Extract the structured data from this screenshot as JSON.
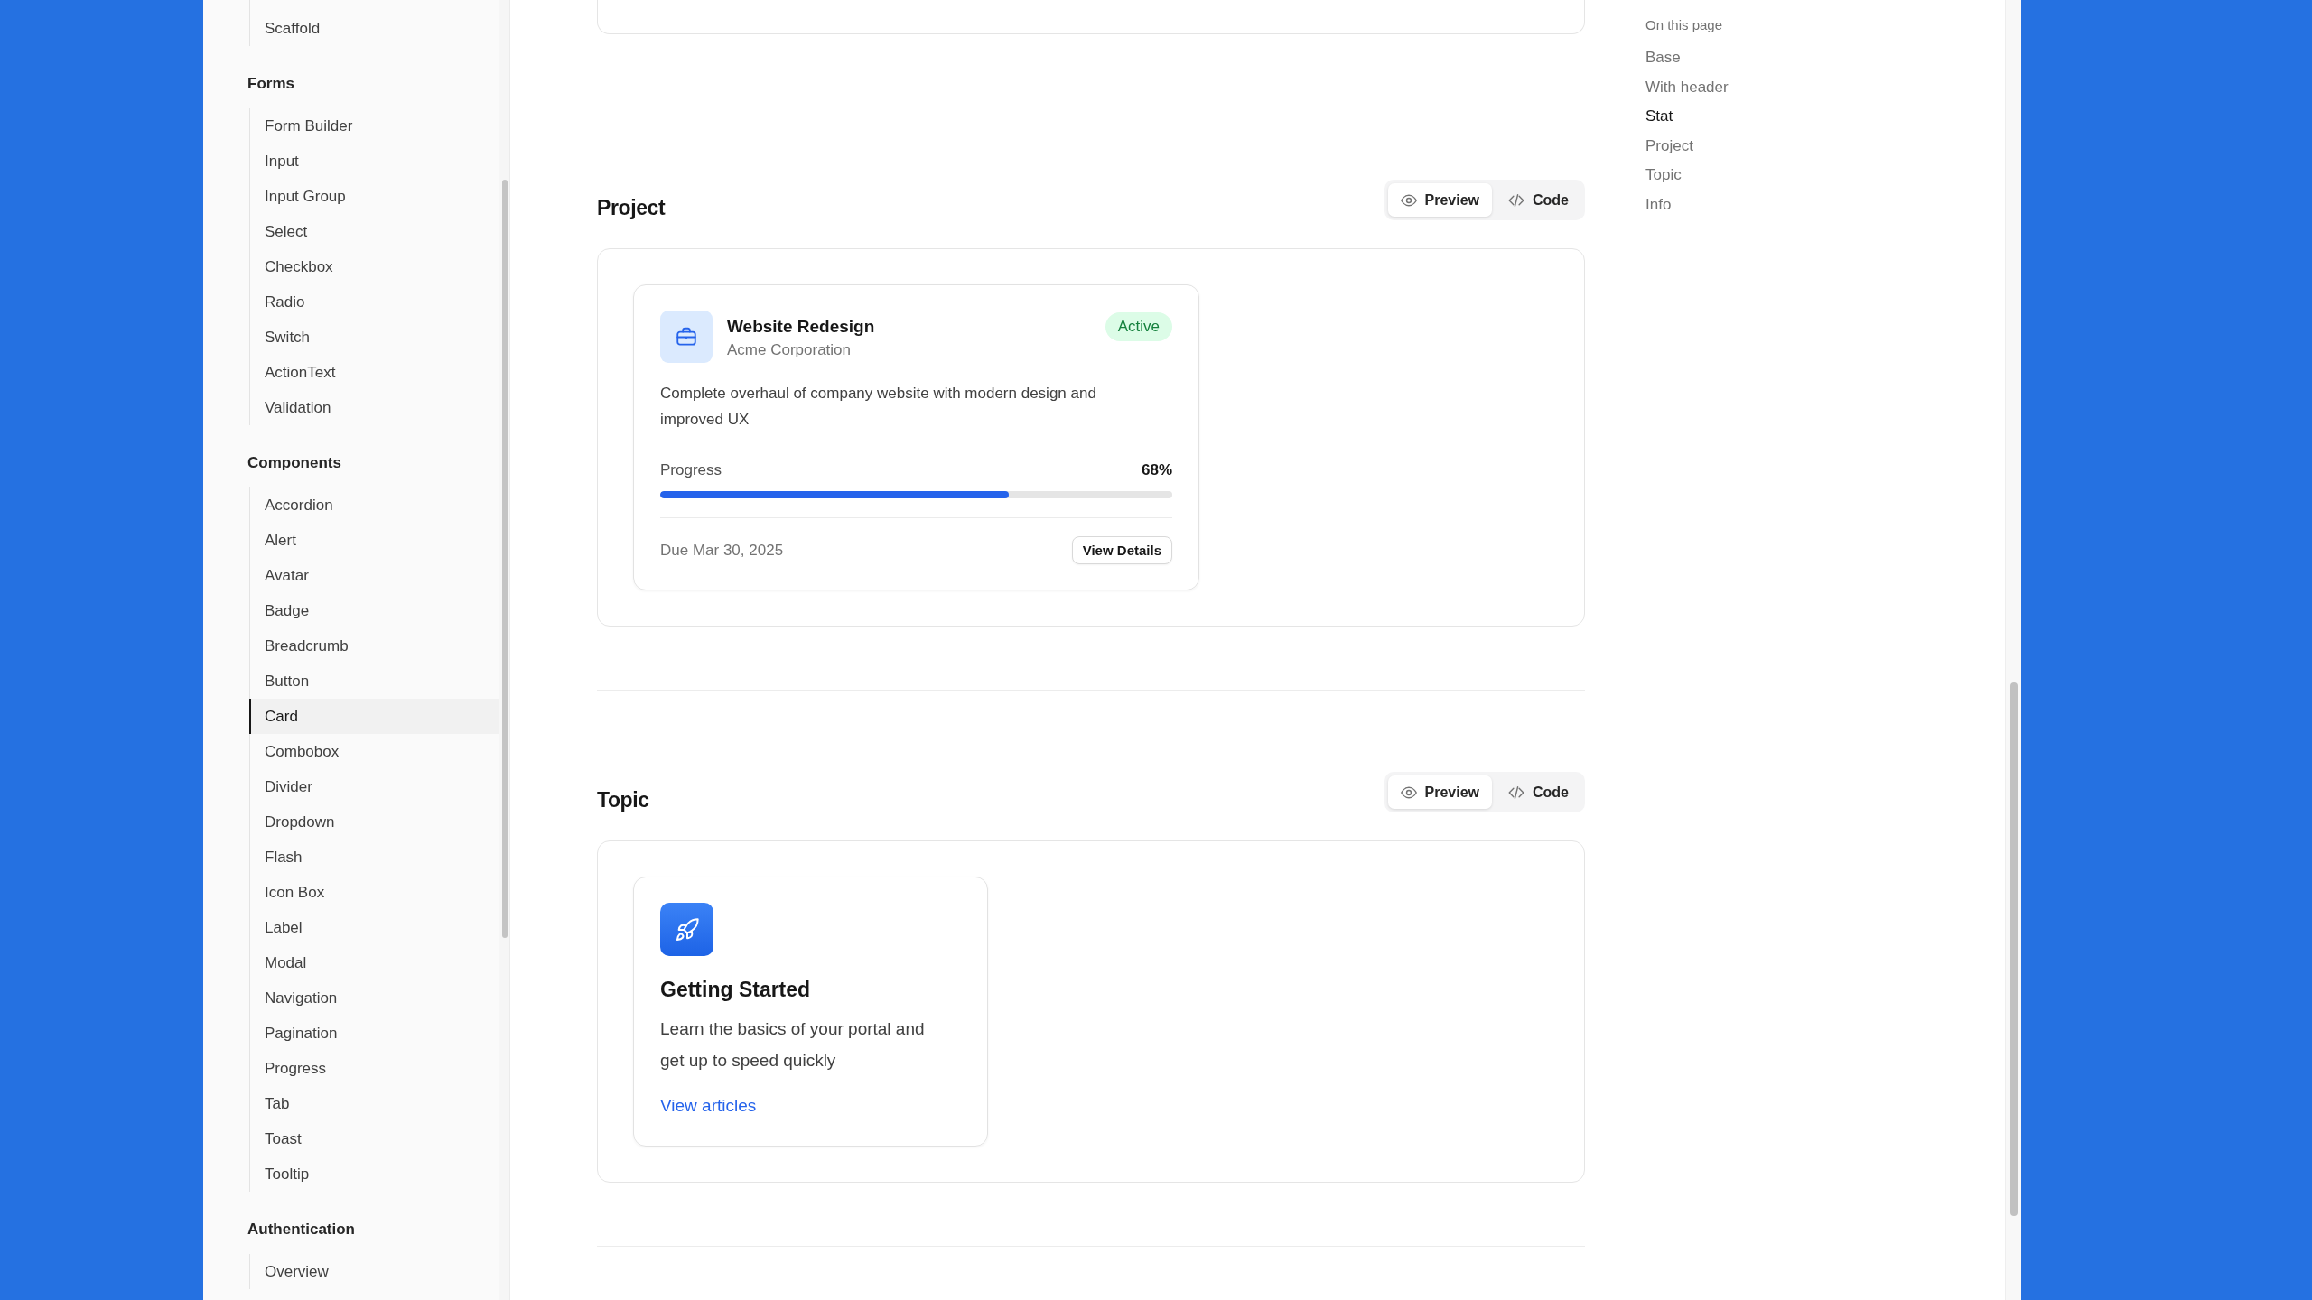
{
  "sidebar": {
    "groups": [
      {
        "items": [
          {
            "label": "Scaffold",
            "selected": false
          }
        ]
      },
      {
        "title": "Forms",
        "items": [
          {
            "label": "Form Builder",
            "selected": false
          },
          {
            "label": "Input",
            "selected": false
          },
          {
            "label": "Input Group",
            "selected": false
          },
          {
            "label": "Select",
            "selected": false
          },
          {
            "label": "Checkbox",
            "selected": false
          },
          {
            "label": "Radio",
            "selected": false
          },
          {
            "label": "Switch",
            "selected": false
          },
          {
            "label": "ActionText",
            "selected": false
          },
          {
            "label": "Validation",
            "selected": false
          }
        ]
      },
      {
        "title": "Components",
        "items": [
          {
            "label": "Accordion",
            "selected": false
          },
          {
            "label": "Alert",
            "selected": false
          },
          {
            "label": "Avatar",
            "selected": false
          },
          {
            "label": "Badge",
            "selected": false
          },
          {
            "label": "Breadcrumb",
            "selected": false
          },
          {
            "label": "Button",
            "selected": false
          },
          {
            "label": "Card",
            "selected": true
          },
          {
            "label": "Combobox",
            "selected": false
          },
          {
            "label": "Divider",
            "selected": false
          },
          {
            "label": "Dropdown",
            "selected": false
          },
          {
            "label": "Flash",
            "selected": false
          },
          {
            "label": "Icon Box",
            "selected": false
          },
          {
            "label": "Label",
            "selected": false
          },
          {
            "label": "Modal",
            "selected": false
          },
          {
            "label": "Navigation",
            "selected": false
          },
          {
            "label": "Pagination",
            "selected": false
          },
          {
            "label": "Progress",
            "selected": false
          },
          {
            "label": "Tab",
            "selected": false
          },
          {
            "label": "Toast",
            "selected": false
          },
          {
            "label": "Tooltip",
            "selected": false
          }
        ]
      },
      {
        "title": "Authentication",
        "items": [
          {
            "label": "Overview",
            "selected": false
          }
        ]
      }
    ]
  },
  "sections": [
    {
      "title": "Project",
      "view_modes": [
        {
          "kind": "preview",
          "label": "Preview",
          "selected": true
        },
        {
          "kind": "code",
          "label": "Code",
          "selected": false
        }
      ],
      "example": {
        "kind": "project",
        "title": "Website Redesign",
        "subtitle": "Acme Corporation",
        "status": "Active",
        "description": "Complete overhaul of company website with modern design and improved UX",
        "progress": {
          "label": "Progress",
          "reading": "68%",
          "level": 0.68
        },
        "due": "Due Mar 30, 2025",
        "action": "View Details"
      }
    },
    {
      "title": "Topic",
      "view_modes": [
        {
          "kind": "preview",
          "label": "Preview",
          "selected": true
        },
        {
          "kind": "code",
          "label": "Code",
          "selected": false
        }
      ],
      "example": {
        "kind": "topic",
        "title": "Getting Started",
        "description": "Learn the basics of your portal and get up to speed quickly",
        "link": "View articles"
      }
    }
  ],
  "toc": {
    "title": "On this page",
    "items": [
      {
        "label": "Base",
        "selected": false
      },
      {
        "label": "With header",
        "selected": false
      },
      {
        "label": "Stat",
        "selected": true
      },
      {
        "label": "Project",
        "selected": false
      },
      {
        "label": "Topic",
        "selected": false
      },
      {
        "label": "Info",
        "selected": false
      }
    ]
  }
}
